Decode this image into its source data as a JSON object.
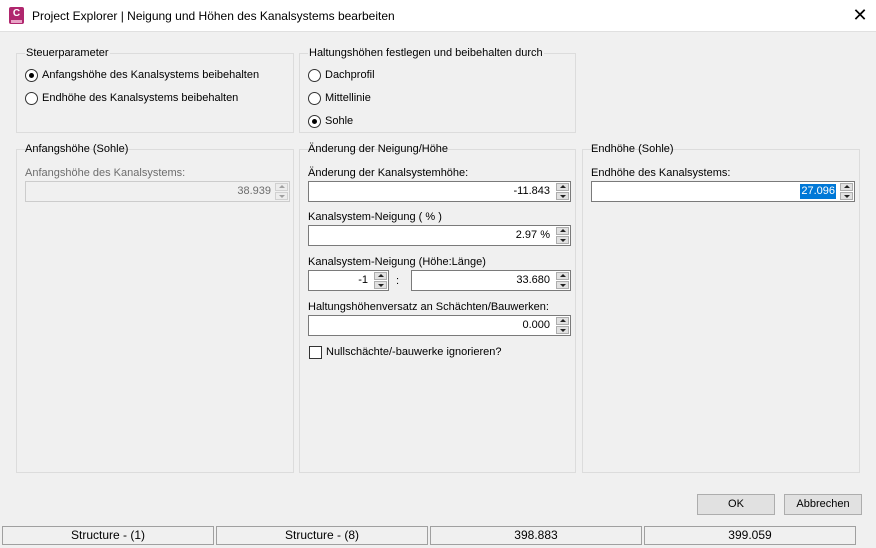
{
  "window": {
    "title": "Project Explorer | Neigung und Höhen des Kanalsystems bearbeiten",
    "app_icon": "C",
    "close": "✕",
    "accent_color": "#b0276e"
  },
  "steuer": {
    "title": "Steuerparameter",
    "options": [
      {
        "label": "Anfangshöhe des Kanalsystems beibehalten",
        "checked": true
      },
      {
        "label": "Endhöhe des Kanalsystems beibehalten",
        "checked": false
      }
    ]
  },
  "haltung": {
    "title": "Haltungshöhen festlegen und beibehalten durch",
    "options": [
      {
        "label": "Dachprofil",
        "checked": false
      },
      {
        "label": "Mittellinie",
        "checked": false
      },
      {
        "label": "Sohle",
        "checked": true
      }
    ]
  },
  "anfang": {
    "title": "Anfangshöhe (Sohle)",
    "label": "Anfangshöhe des Kanalsystems:",
    "value": "38.939"
  },
  "aenderung": {
    "title": "Änderung der Neigung/Höhe",
    "hoehe_label": "Änderung der Kanalsystemhöhe:",
    "hoehe_value": "-11.843",
    "neigung_pct_label": "Kanalsystem-Neigung ( % )",
    "neigung_pct_value": "2.97 %",
    "neigung_ratio_label": "Kanalsystem-Neigung (Höhe:Länge)",
    "ratio_left": "-1",
    "ratio_sep": ":",
    "ratio_right": "33.680",
    "versatz_label": "Haltungshöhenversatz an Schächten/Bauwerken:",
    "versatz_value": "0.000",
    "null_label": "Nullschächte/-bauwerke ignorieren?"
  },
  "ende": {
    "title": "Endhöhe (Sohle)",
    "label": "Endhöhe des Kanalsystems:",
    "value": "27.096"
  },
  "buttons": {
    "ok": "OK",
    "cancel": "Abbrechen"
  },
  "status": [
    "Structure - (1)",
    "Structure - (8)",
    "398.883",
    "399.059"
  ]
}
